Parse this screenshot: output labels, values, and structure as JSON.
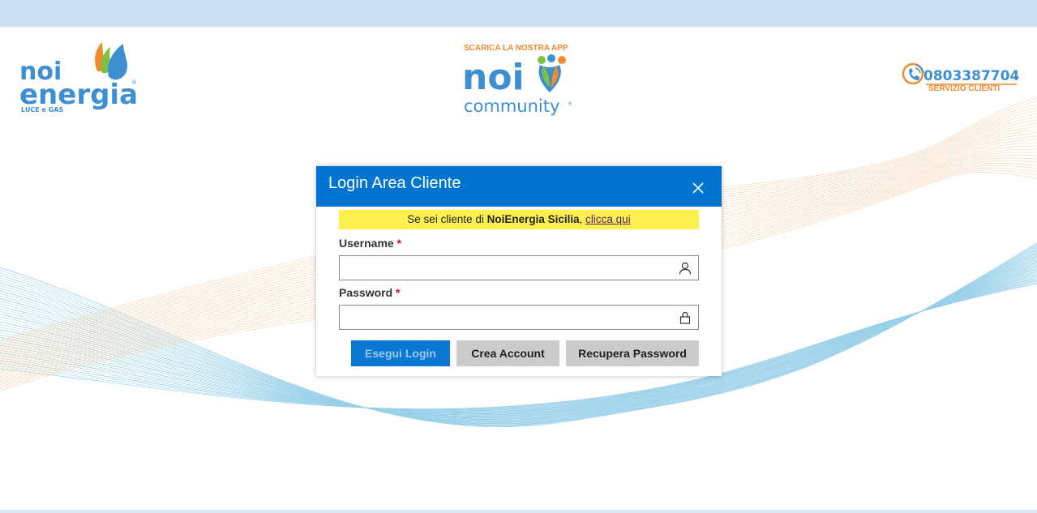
{
  "header": {
    "app_promo": "SCARICA LA NOSTRA APP",
    "brand_logo_text": "noi energia",
    "brand_logo_sub": "LUCE e GAS",
    "community_logo_text": "noi community",
    "phone_number": "0803387704",
    "phone_label": "SERVIZIO CLIENTI"
  },
  "dialog": {
    "title": "Login Area Cliente",
    "notice_prefix": "Se sei cliente di ",
    "notice_brand": "NoiEnergia Sicilia",
    "notice_sep": ", ",
    "notice_link": "clicca qui",
    "username_label": "Username",
    "password_label": "Password",
    "required_mark": "*",
    "username_value": "",
    "password_value": "",
    "login_button": "Esegui Login",
    "create_button": "Crea Account",
    "recover_button": "Recupera Password"
  },
  "icons": {
    "close": "close-icon",
    "user": "user-icon",
    "lock": "lock-icon",
    "phone": "phone-icon"
  },
  "colors": {
    "header_blue": "#0075cf",
    "notice_yellow": "#fdf04f",
    "brand_blue": "#3d8fd1",
    "brand_orange": "#f08a2c",
    "top_bar": "#c9dff1"
  }
}
